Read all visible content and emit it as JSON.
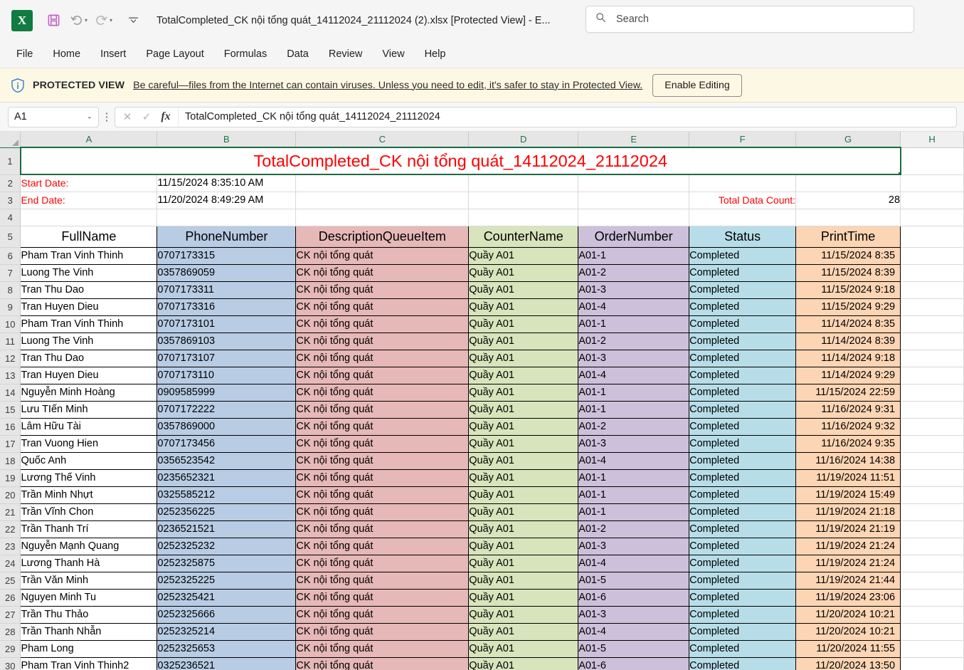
{
  "titlebar": {
    "logo_text": "X",
    "document_title": "TotalCompleted_CK nội tổng quát_14112024_21112024 (2).xlsx  [Protected View]  -  E...",
    "search_placeholder": "Search",
    "qat": {
      "save": "save-icon",
      "undo": "undo-icon",
      "redo": "redo-icon",
      "customize": "customize-quick-access-toolbar-icon"
    }
  },
  "ribbon": {
    "tabs": [
      "File",
      "Home",
      "Insert",
      "Page Layout",
      "Formulas",
      "Data",
      "Review",
      "View",
      "Help"
    ]
  },
  "protected_view": {
    "label": "PROTECTED VIEW",
    "message": "Be careful—files from the Internet can contain viruses. Unless you need to edit, it's safer to stay in Protected View.",
    "button": "Enable Editing"
  },
  "formula_bar": {
    "name_box": "A1",
    "cancel": "✕",
    "confirm": "✓",
    "fx": "fx",
    "value": "TotalCompleted_CK nội tổng quát_14112024_21112024"
  },
  "grid": {
    "column_letters": [
      "A",
      "B",
      "C",
      "D",
      "E",
      "F",
      "G",
      "H"
    ],
    "title_row": {
      "row_number": "1",
      "text": "TotalCompleted_CK nội tổng quát_14112024_21112024"
    },
    "meta_rows": [
      {
        "row_number": "2",
        "label": "Start Date:",
        "value": "11/15/2024 8:35:10 AM",
        "count_label": "",
        "count_value": ""
      },
      {
        "row_number": "3",
        "label": "End Date:",
        "value": "11/20/2024 8:49:29 AM",
        "count_label": "Total Data Count:",
        "count_value": "28"
      },
      {
        "row_number": "4",
        "label": "",
        "value": "",
        "count_label": "",
        "count_value": ""
      }
    ],
    "header_row_number": "5",
    "headers": [
      "FullName",
      "PhoneNumber",
      "DescriptionQueueItem",
      "CounterName",
      "OrderNumber",
      "Status",
      "PrintTime"
    ],
    "rows": [
      {
        "n": "6",
        "cells": [
          "Pham Tran Vinh Thinh",
          "0707173315",
          "CK nội tổng quát",
          "Quầy A01",
          "A01-1",
          "Completed",
          "11/15/2024 8:35"
        ]
      },
      {
        "n": "7",
        "cells": [
          "Luong The Vinh",
          "0357869059",
          "CK nội tổng quát",
          "Quầy A01",
          "A01-2",
          "Completed",
          "11/15/2024 8:39"
        ]
      },
      {
        "n": "8",
        "cells": [
          "Tran Thu Dao",
          "0707173311",
          "CK nội tổng quát",
          "Quầy A01",
          "A01-3",
          "Completed",
          "11/15/2024 9:18"
        ]
      },
      {
        "n": "9",
        "cells": [
          "Tran Huyen Dieu",
          "0707173316",
          "CK nội tổng quát",
          "Quầy A01",
          "A01-4",
          "Completed",
          "11/15/2024 9:29"
        ]
      },
      {
        "n": "10",
        "cells": [
          "Pham Tran Vinh Thinh",
          "0707173101",
          "CK nội tổng quát",
          "Quầy A01",
          "A01-1",
          "Completed",
          "11/14/2024 8:35"
        ]
      },
      {
        "n": "11",
        "cells": [
          "Luong The Vinh",
          "0357869103",
          "CK nội tổng quát",
          "Quầy A01",
          "A01-2",
          "Completed",
          "11/14/2024 8:39"
        ]
      },
      {
        "n": "12",
        "cells": [
          "Tran Thu Dao",
          "0707173107",
          "CK nội tổng quát",
          "Quầy A01",
          "A01-3",
          "Completed",
          "11/14/2024 9:18"
        ]
      },
      {
        "n": "13",
        "cells": [
          "Tran Huyen Dieu",
          "0707173110",
          "CK nội tổng quát",
          "Quầy A01",
          "A01-4",
          "Completed",
          "11/14/2024 9:29"
        ]
      },
      {
        "n": "14",
        "cells": [
          "Nguyễn Minh Hoàng",
          "0909585999",
          "CK nội tổng quát",
          "Quầy A01",
          "A01-1",
          "Completed",
          "11/15/2024 22:59"
        ]
      },
      {
        "n": "15",
        "cells": [
          "Lưu TIến Minh",
          "0707172222",
          "CK nội tổng quát",
          "Quầy A01",
          "A01-1",
          "Completed",
          "11/16/2024 9:31"
        ]
      },
      {
        "n": "16",
        "cells": [
          "Lâm Hữu Tài",
          "0357869000",
          "CK nội tổng quát",
          "Quầy A01",
          "A01-2",
          "Completed",
          "11/16/2024 9:32"
        ]
      },
      {
        "n": "17",
        "cells": [
          "Tran Vuong Hien",
          "0707173456",
          "CK nội tổng quát",
          "Quầy A01",
          "A01-3",
          "Completed",
          "11/16/2024 9:35"
        ]
      },
      {
        "n": "18",
        "cells": [
          "Quốc Anh",
          "0356523542",
          "CK nội tổng quát",
          "Quầy A01",
          "A01-4",
          "Completed",
          "11/16/2024 14:38"
        ]
      },
      {
        "n": "19",
        "cells": [
          "Lương Thế Vinh",
          "0235652321",
          "CK nội tổng quát",
          "Quầy A01",
          "A01-1",
          "Completed",
          "11/19/2024 11:51"
        ]
      },
      {
        "n": "20",
        "cells": [
          "Trần Minh Nhựt",
          "0325585212",
          "CK nội tổng quát",
          "Quầy A01",
          "A01-1",
          "Completed",
          "11/19/2024 15:49"
        ]
      },
      {
        "n": "21",
        "cells": [
          "Trần Vĩnh Chon",
          "0252356225",
          "CK nội tổng quát",
          "Quầy A01",
          "A01-1",
          "Completed",
          "11/19/2024 21:18"
        ]
      },
      {
        "n": "22",
        "cells": [
          "Trần Thanh Trí",
          "0236521521",
          "CK nội tổng quát",
          "Quầy A01",
          "A01-2",
          "Completed",
          "11/19/2024 21:19"
        ]
      },
      {
        "n": "23",
        "cells": [
          "Nguyễn Mạnh Quang",
          "0252325232",
          "CK nội tổng quát",
          "Quầy A01",
          "A01-3",
          "Completed",
          "11/19/2024 21:24"
        ]
      },
      {
        "n": "24",
        "cells": [
          "Lương Thanh Hà",
          "0252325875",
          "CK nội tổng quát",
          "Quầy A01",
          "A01-4",
          "Completed",
          "11/19/2024 21:24"
        ]
      },
      {
        "n": "25",
        "cells": [
          "Trần Văn Minh",
          "0252325225",
          "CK nội tổng quát",
          "Quầy A01",
          "A01-5",
          "Completed",
          "11/19/2024 21:44"
        ]
      },
      {
        "n": "26",
        "cells": [
          "Nguyen Minh Tu",
          "0252325421",
          "CK nội tổng quát",
          "Quầy A01",
          "A01-6",
          "Completed",
          "11/19/2024 23:06"
        ]
      },
      {
        "n": "27",
        "cells": [
          "Trần Thu Thảo",
          "0252325666",
          "CK nội tổng quát",
          "Quầy A01",
          "A01-3",
          "Completed",
          "11/20/2024 10:21"
        ]
      },
      {
        "n": "28",
        "cells": [
          "Trần Thanh Nhẫn",
          "0252325214",
          "CK nội tổng quát",
          "Quầy A01",
          "A01-4",
          "Completed",
          "11/20/2024 10:21"
        ]
      },
      {
        "n": "29",
        "cells": [
          "Pham Long",
          "0252325653",
          "CK nội tổng quát",
          "Quầy A01",
          "A01-5",
          "Completed",
          "11/20/2024 11:55"
        ]
      },
      {
        "n": "30",
        "cells": [
          "Pham Tran Vinh Thinh2",
          "0325236521",
          "CK nội tổng quát",
          "Quầy A01",
          "A01-6",
          "Completed",
          "11/20/2024 13:50"
        ]
      }
    ]
  },
  "colors": {
    "title_text": "#ff0000",
    "header_fills": [
      "#ffffff",
      "#b8cce4",
      "#e6b8b7",
      "#d8e4bc",
      "#ccc0da",
      "#b7dee8",
      "#fcd5b4"
    ],
    "excel_green": "#107c41",
    "protected_view_bg": "#fdf8e3"
  }
}
